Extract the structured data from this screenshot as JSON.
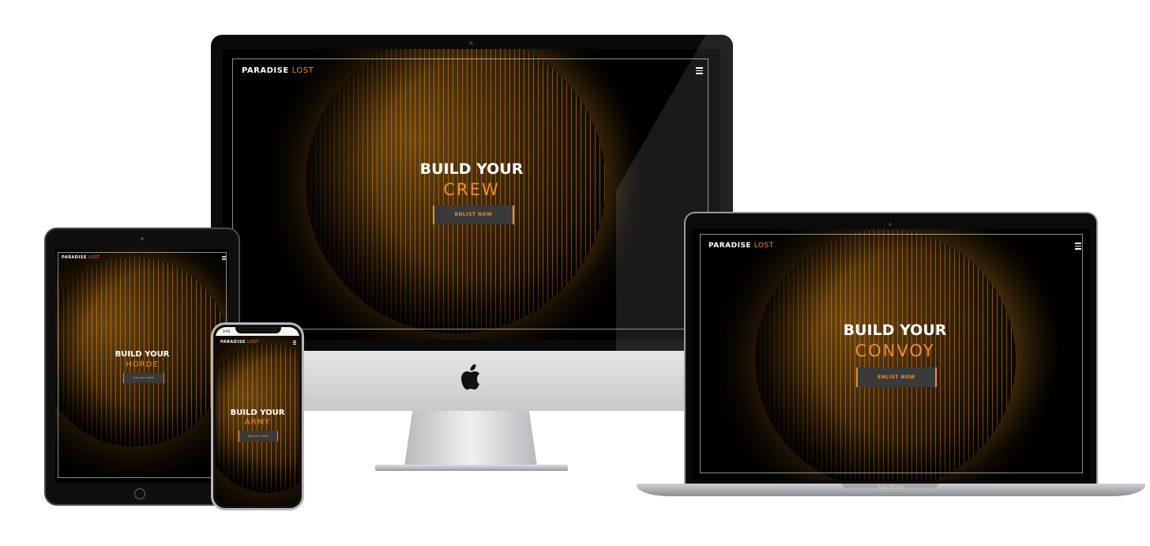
{
  "site": {
    "brand_primary": "PARADISE",
    "brand_secondary": "LOST",
    "cta_label": "ENLIST NOW",
    "headline_prefix": "BUILD YOUR",
    "accent_color": "#f28d28"
  },
  "devices": {
    "imac": {
      "headline_word": "CREW"
    },
    "macbook": {
      "headline_word": "CONVOY",
      "label": "MacBook"
    },
    "ipad": {
      "headline_word": "HORDE"
    },
    "iphone": {
      "headline_word": "ARMY",
      "status_time": "9:41"
    }
  },
  "icons": [
    "hamburger-menu-icon",
    "apple-logo-icon"
  ]
}
